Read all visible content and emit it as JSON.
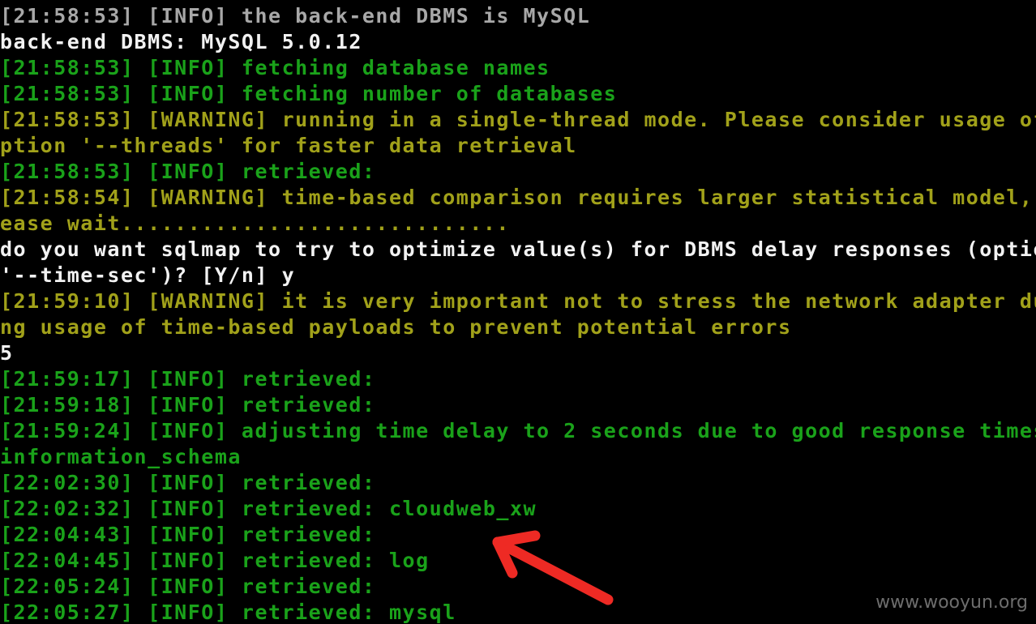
{
  "terminal": {
    "lines": [
      {
        "text": "[21:58:53] [INFO] the back-end DBMS is MySQL",
        "color": "#a8a8a8"
      },
      {
        "text": "back-end DBMS: MySQL 5.0.12",
        "color": "#f2f2f2"
      },
      {
        "text": "[21:58:53] [INFO] fetching database names",
        "color": "#1aa21a"
      },
      {
        "text": "[21:58:53] [INFO] fetching number of databases",
        "color": "#1aa21a"
      },
      {
        "text": "[21:58:53] [WARNING] running in a single-thread mode. Please consider usage of o",
        "color": "#a1a11a"
      },
      {
        "text": "ption '--threads' for faster data retrieval",
        "color": "#a1a11a"
      },
      {
        "text": "[21:58:53] [INFO] retrieved:",
        "color": "#1aa21a"
      },
      {
        "text": "[21:58:54] [WARNING] time-based comparison requires larger statistical model, pl",
        "color": "#a1a11a"
      },
      {
        "text": "ease wait.............................",
        "color": "#a1a11a"
      },
      {
        "text": "do you want sqlmap to try to optimize value(s) for DBMS delay responses (option",
        "color": "#f2f2f2"
      },
      {
        "text": "'--time-sec')? [Y/n] y",
        "color": "#f2f2f2"
      },
      {
        "text": "[21:59:10] [WARNING] it is very important not to stress the network adapter duri",
        "color": "#a1a11a"
      },
      {
        "text": "ng usage of time-based payloads to prevent potential errors",
        "color": "#a1a11a"
      },
      {
        "text": "5",
        "color": "#f2f2f2"
      },
      {
        "text": "[21:59:17] [INFO] retrieved:",
        "color": "#1aa21a"
      },
      {
        "text": "[21:59:18] [INFO] retrieved:",
        "color": "#1aa21a"
      },
      {
        "text": "[21:59:24] [INFO] adjusting time delay to 2 seconds due to good response times",
        "color": "#1aa21a"
      },
      {
        "text": "information_schema",
        "color": "#1aa21a"
      },
      {
        "text": "[22:02:30] [INFO] retrieved:",
        "color": "#1aa21a"
      },
      {
        "text": "[22:02:32] [INFO] retrieved: cloudweb_xw",
        "color": "#1aa21a"
      },
      {
        "text": "[22:04:43] [INFO] retrieved:",
        "color": "#1aa21a"
      },
      {
        "text": "[22:04:45] [INFO] retrieved: log",
        "color": "#1aa21a"
      },
      {
        "text": "[22:05:24] [INFO] retrieved:",
        "color": "#1aa21a"
      },
      {
        "text": "[22:05:27] [INFO] retrieved: mysql",
        "color": "#1aa21a"
      }
    ]
  },
  "annotation": {
    "icon": "red-arrow-icon",
    "color": "#ee2a24"
  },
  "watermark": {
    "text": "www.wooyun.org"
  },
  "colors": {
    "background": "#000000",
    "info_green": "#1aa21a",
    "warning_olive": "#a1a11a",
    "plain_white": "#f2f2f2",
    "dim_gray": "#a8a8a8"
  }
}
